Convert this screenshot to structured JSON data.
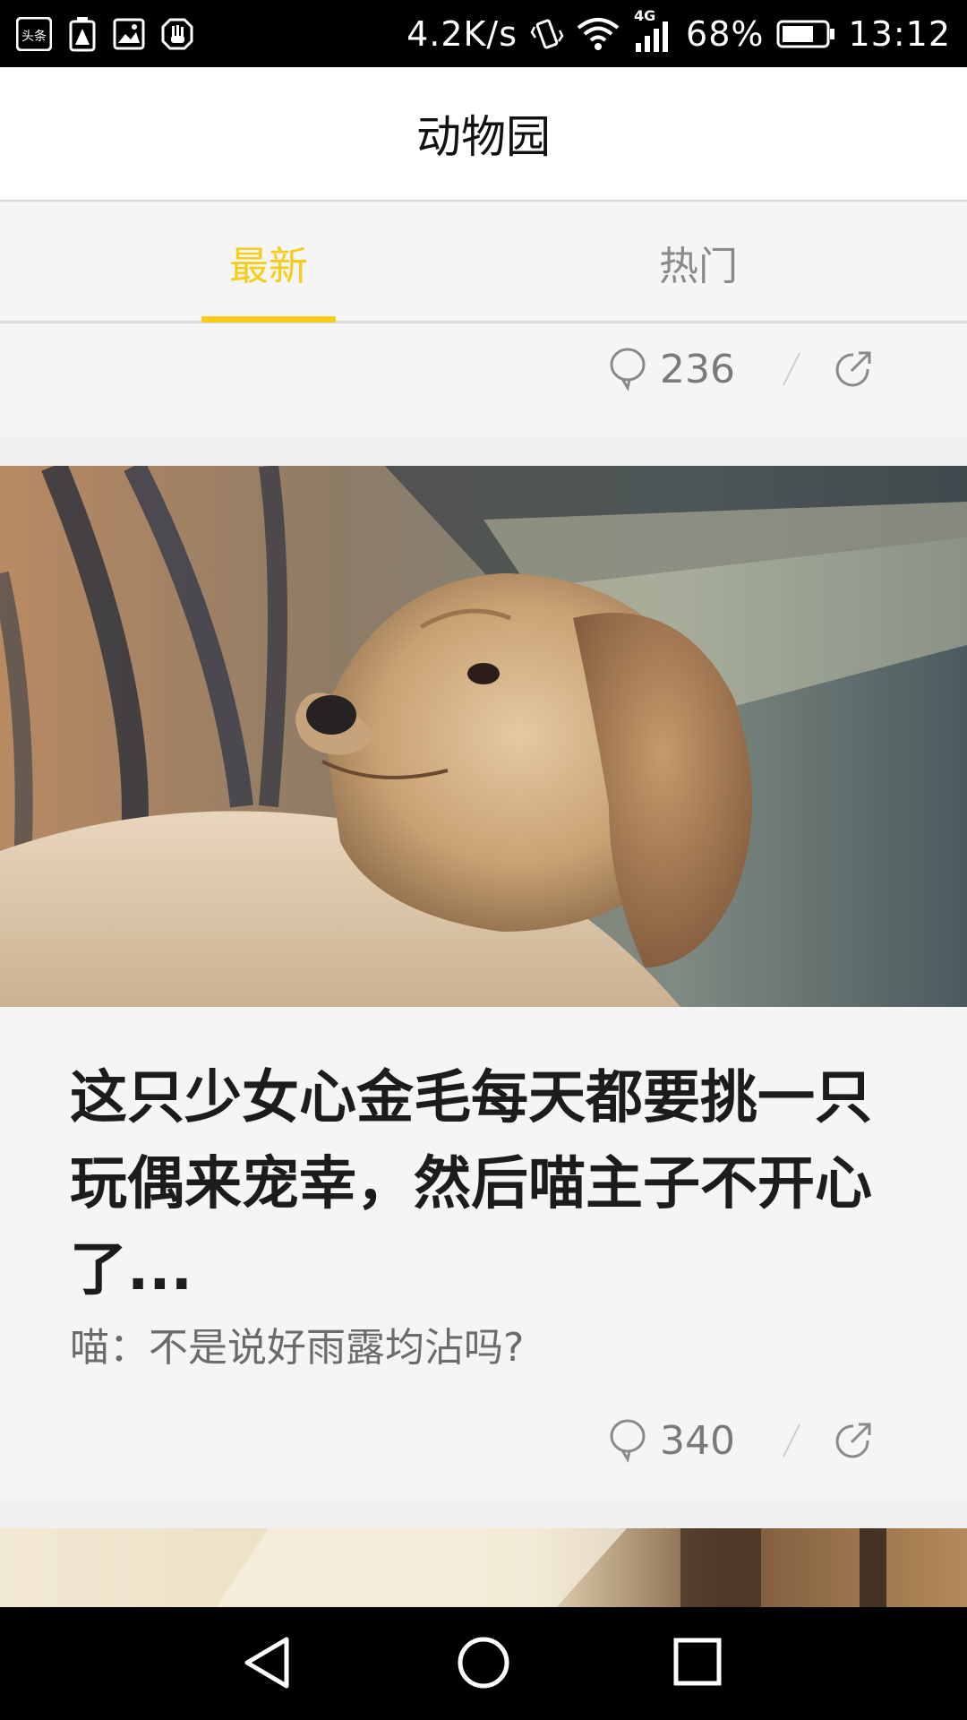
{
  "status_bar": {
    "left_icons": [
      "toutiao-app-icon",
      "battery-warning-icon",
      "image-icon",
      "hand-icon"
    ],
    "toutiao_text": "头条",
    "net_speed": "4.2K/s",
    "network_type": "4G",
    "battery_percent": "68%",
    "time": "13:12"
  },
  "header": {
    "title": "动物园"
  },
  "tabs": [
    {
      "label": "最新",
      "active": true
    },
    {
      "label": "热门",
      "active": false
    }
  ],
  "colors": {
    "accent": "#f6cc16",
    "inactive_tab": "#8a8a8a"
  },
  "feed": {
    "partial_card": {
      "comment_count": "236"
    },
    "card": {
      "image_icon": "dog-photo",
      "title": "这只少女心金毛每天都要挑一只玩偶来宠幸，然后喵主子不开心了...",
      "subtitle": "喵：不是说好雨露均沾吗?",
      "comment_count": "340"
    }
  },
  "nav_bar": {
    "buttons": [
      "back-icon",
      "home-icon",
      "recents-icon"
    ]
  }
}
